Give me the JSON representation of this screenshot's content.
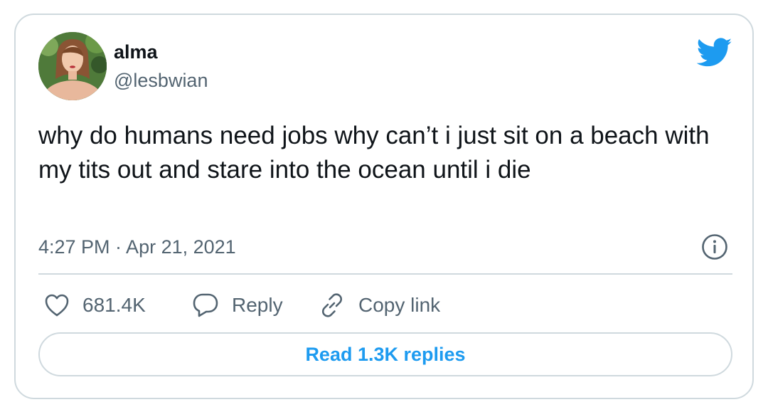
{
  "author": {
    "display_name": "alma",
    "handle": "@lesbwian",
    "avatar_icon": "profile-photo"
  },
  "tweet": {
    "text": "why do humans need jobs why can’t i just sit on a beach with my tits out and stare into the ocean until i die",
    "timestamp": "4:27 PM · Apr 21, 2021"
  },
  "actions": {
    "likes_count": "681.4K",
    "reply_label": "Reply",
    "copy_link_label": "Copy link",
    "read_replies_label": "Read 1.3K replies"
  },
  "icons": {
    "brand": "twitter-bird-icon",
    "info": "info-icon",
    "like": "heart-icon",
    "reply": "speech-bubble-icon",
    "copy": "link-icon"
  },
  "colors": {
    "brand_blue": "#1d9bf0",
    "text_primary": "#0f1419",
    "text_secondary": "#536471",
    "border": "#cfd9de"
  }
}
